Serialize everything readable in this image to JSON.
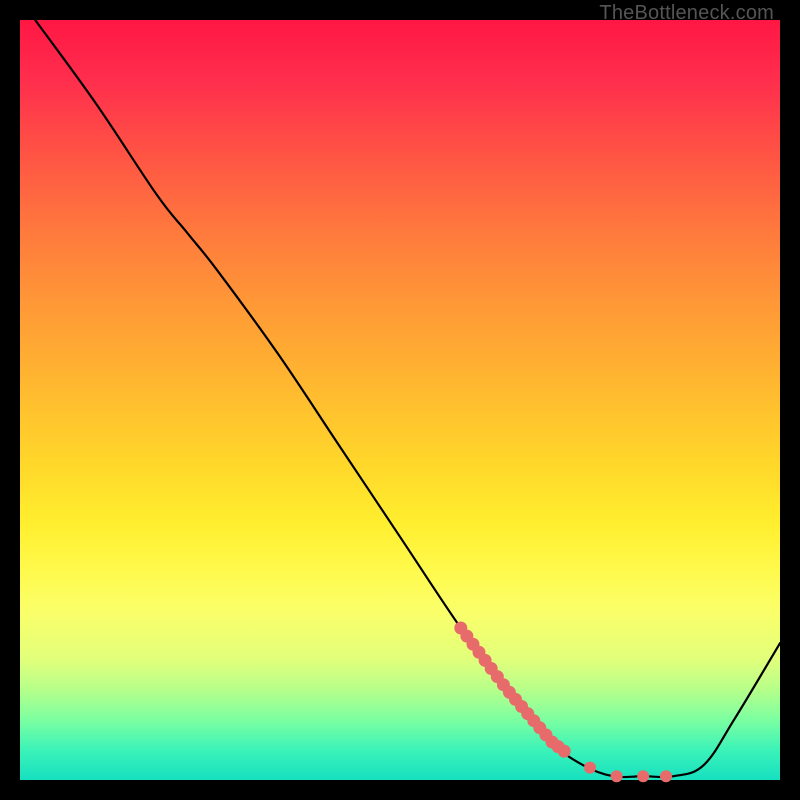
{
  "watermark": {
    "text": "TheBottleneck.com"
  },
  "colors": {
    "curve": "#000000",
    "markers": "#e86b6b"
  },
  "chart_data": {
    "type": "line",
    "title": "",
    "xlabel": "",
    "ylabel": "",
    "xlim": [
      0,
      100
    ],
    "ylim": [
      0,
      100
    ],
    "grid": false,
    "legend": false,
    "series": [
      {
        "name": "bottleneck_curve",
        "x": [
          2,
          10,
          18,
          22,
          26,
          34,
          42,
          50,
          58,
          64,
          70,
          74,
          78,
          82,
          86,
          90,
          94,
          100
        ],
        "y": [
          100,
          89,
          77,
          72,
          67,
          56,
          44,
          32,
          20,
          12,
          5,
          2,
          0.5,
          0.5,
          0.5,
          2,
          8,
          18
        ]
      }
    ],
    "annotations": {
      "marker_band": {
        "start_x": 58,
        "end_x": 72,
        "description": "dense salmon markers along the curve"
      },
      "marker_dots": {
        "x": [
          75,
          78.5,
          82,
          85
        ],
        "description": "sparse salmon markers near trough"
      }
    }
  }
}
